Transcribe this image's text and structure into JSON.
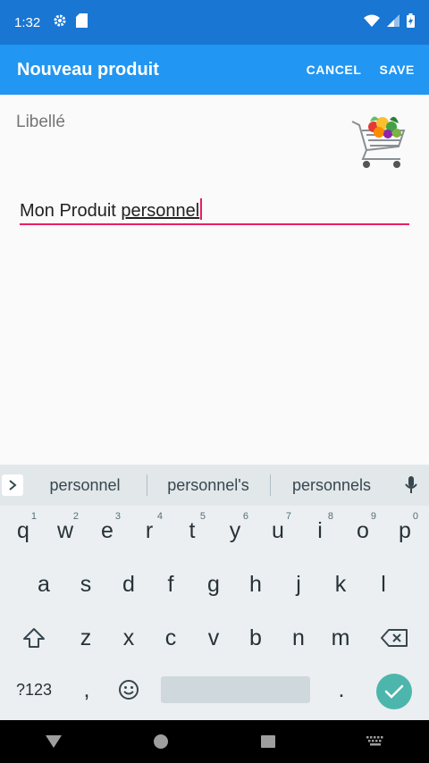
{
  "status_bar": {
    "time": "1:32",
    "icons_left": [
      "gear-icon",
      "sd-card-icon"
    ],
    "icons_right": [
      "wifi-icon",
      "signal-icon",
      "battery-charging-icon"
    ]
  },
  "app_bar": {
    "title": "Nouveau produit",
    "cancel_label": "CANCEL",
    "save_label": "SAVE",
    "color": "#2196f3"
  },
  "form": {
    "field_label": "Libellé",
    "image": "grocery-cart-image",
    "input_value_prefix": "Mon Produit ",
    "input_value_composing": "personnel",
    "accent_color": "#e91e63"
  },
  "keyboard": {
    "suggestions": [
      "personnel",
      "personnel's",
      "personnels"
    ],
    "row1": [
      {
        "label": "q",
        "hint": "1"
      },
      {
        "label": "w",
        "hint": "2"
      },
      {
        "label": "e",
        "hint": "3"
      },
      {
        "label": "r",
        "hint": "4"
      },
      {
        "label": "t",
        "hint": "5"
      },
      {
        "label": "y",
        "hint": "6"
      },
      {
        "label": "u",
        "hint": "7"
      },
      {
        "label": "i",
        "hint": "8"
      },
      {
        "label": "o",
        "hint": "9"
      },
      {
        "label": "p",
        "hint": "0"
      }
    ],
    "row2": [
      "a",
      "s",
      "d",
      "f",
      "g",
      "h",
      "j",
      "k",
      "l"
    ],
    "row3": [
      "z",
      "x",
      "c",
      "v",
      "b",
      "n",
      "m"
    ],
    "symbols_label": "?123",
    "comma_label": ",",
    "period_label": "."
  },
  "nav_bar": {
    "buttons": [
      "back-icon",
      "home-icon",
      "recents-icon",
      "keyboard-switch-icon"
    ]
  }
}
